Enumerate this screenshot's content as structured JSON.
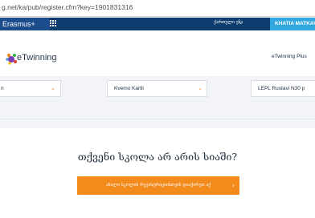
{
  "browser": {
    "url": "g.net/ka/pub/register.cfm?key=1901831316"
  },
  "header": {
    "erasmus_label": "Erasmus+",
    "language_label": "ქართული ენა",
    "user_name": "KHATIA MATKAVA",
    "colors": {
      "bar": "#0c3c6e",
      "erasmus": "#1b4d8c",
      "user": "#33a8e0"
    }
  },
  "brand": {
    "logo_text": "eTwinning",
    "plus_link": "eTwinning Plus"
  },
  "filters": {
    "country": "n",
    "region": "Kvemo Kartli",
    "school": "LEPL Rustavi N30 p"
  },
  "main": {
    "question": "თქვენი სკოლა არ არის სიაში?",
    "cta_label": "ახალი სკოლის რეგისტრაციისთვის დააჭირეთ აქ",
    "accent": "#f28a1c"
  }
}
